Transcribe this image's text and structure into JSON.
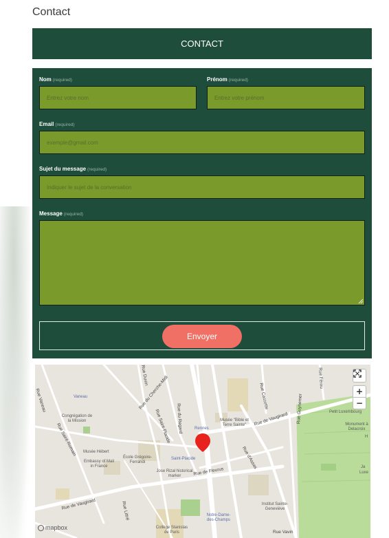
{
  "page": {
    "title": "Contact"
  },
  "banner": {
    "label": "CONTACT"
  },
  "form": {
    "required_tag": "(required)",
    "nom": {
      "label": "Nom",
      "placeholder": "Entrez votre nom"
    },
    "prenom": {
      "label": "Prénom",
      "placeholder": "Entrez votre prénom"
    },
    "email": {
      "label": "Email",
      "placeholder": "exemple@gmail.com"
    },
    "sujet": {
      "label": "Sujet du message",
      "placeholder": "Indiquer le sujet de la conversation"
    },
    "message": {
      "label": "Message",
      "placeholder": ""
    },
    "submit_label": "Envoyer"
  },
  "colors": {
    "panel": "#1e4d3c",
    "field": "#7a9a2c",
    "button": "#f07065",
    "marker": "#e8231e"
  },
  "map": {
    "attribution": "mapbox",
    "controls": {
      "fullscreen": "fullscreen-icon",
      "zoom_in": "+",
      "zoom_out": "−"
    },
    "streets": [
      "Rue Vaneau",
      "Rue Saint-Romain",
      "Rue du Cherche-Midi",
      "Rue Saint-Placide",
      "Rue du Regard",
      "Rue de Vaugirard",
      "Rue d'Assas",
      "Rue Guynemer",
      "Rue de Fleurus",
      "Rue Littré",
      "Rue Cassette",
      "Rue Férou",
      "Rue Duvin",
      "Rue de Vaugirard",
      "Rue Vavin"
    ],
    "places": [
      "Vaneau",
      "Congrégation de la Mission",
      "Musée Hébert",
      "Embassy of Mali in France",
      "École Grégoire-Ferrandi",
      "Jose Rizal historical marker",
      "Rennes",
      "Saint-Placide",
      "Musée \"Bible et Terre Sainte\"",
      "Petit Luxembourg",
      "Monument à Delacroix",
      "Institut Sainte-Geneviève",
      "Notre-Dame-des-Champs",
      "Collège Stanislas de Paris",
      "Luxe",
      "Ja",
      "H"
    ]
  }
}
